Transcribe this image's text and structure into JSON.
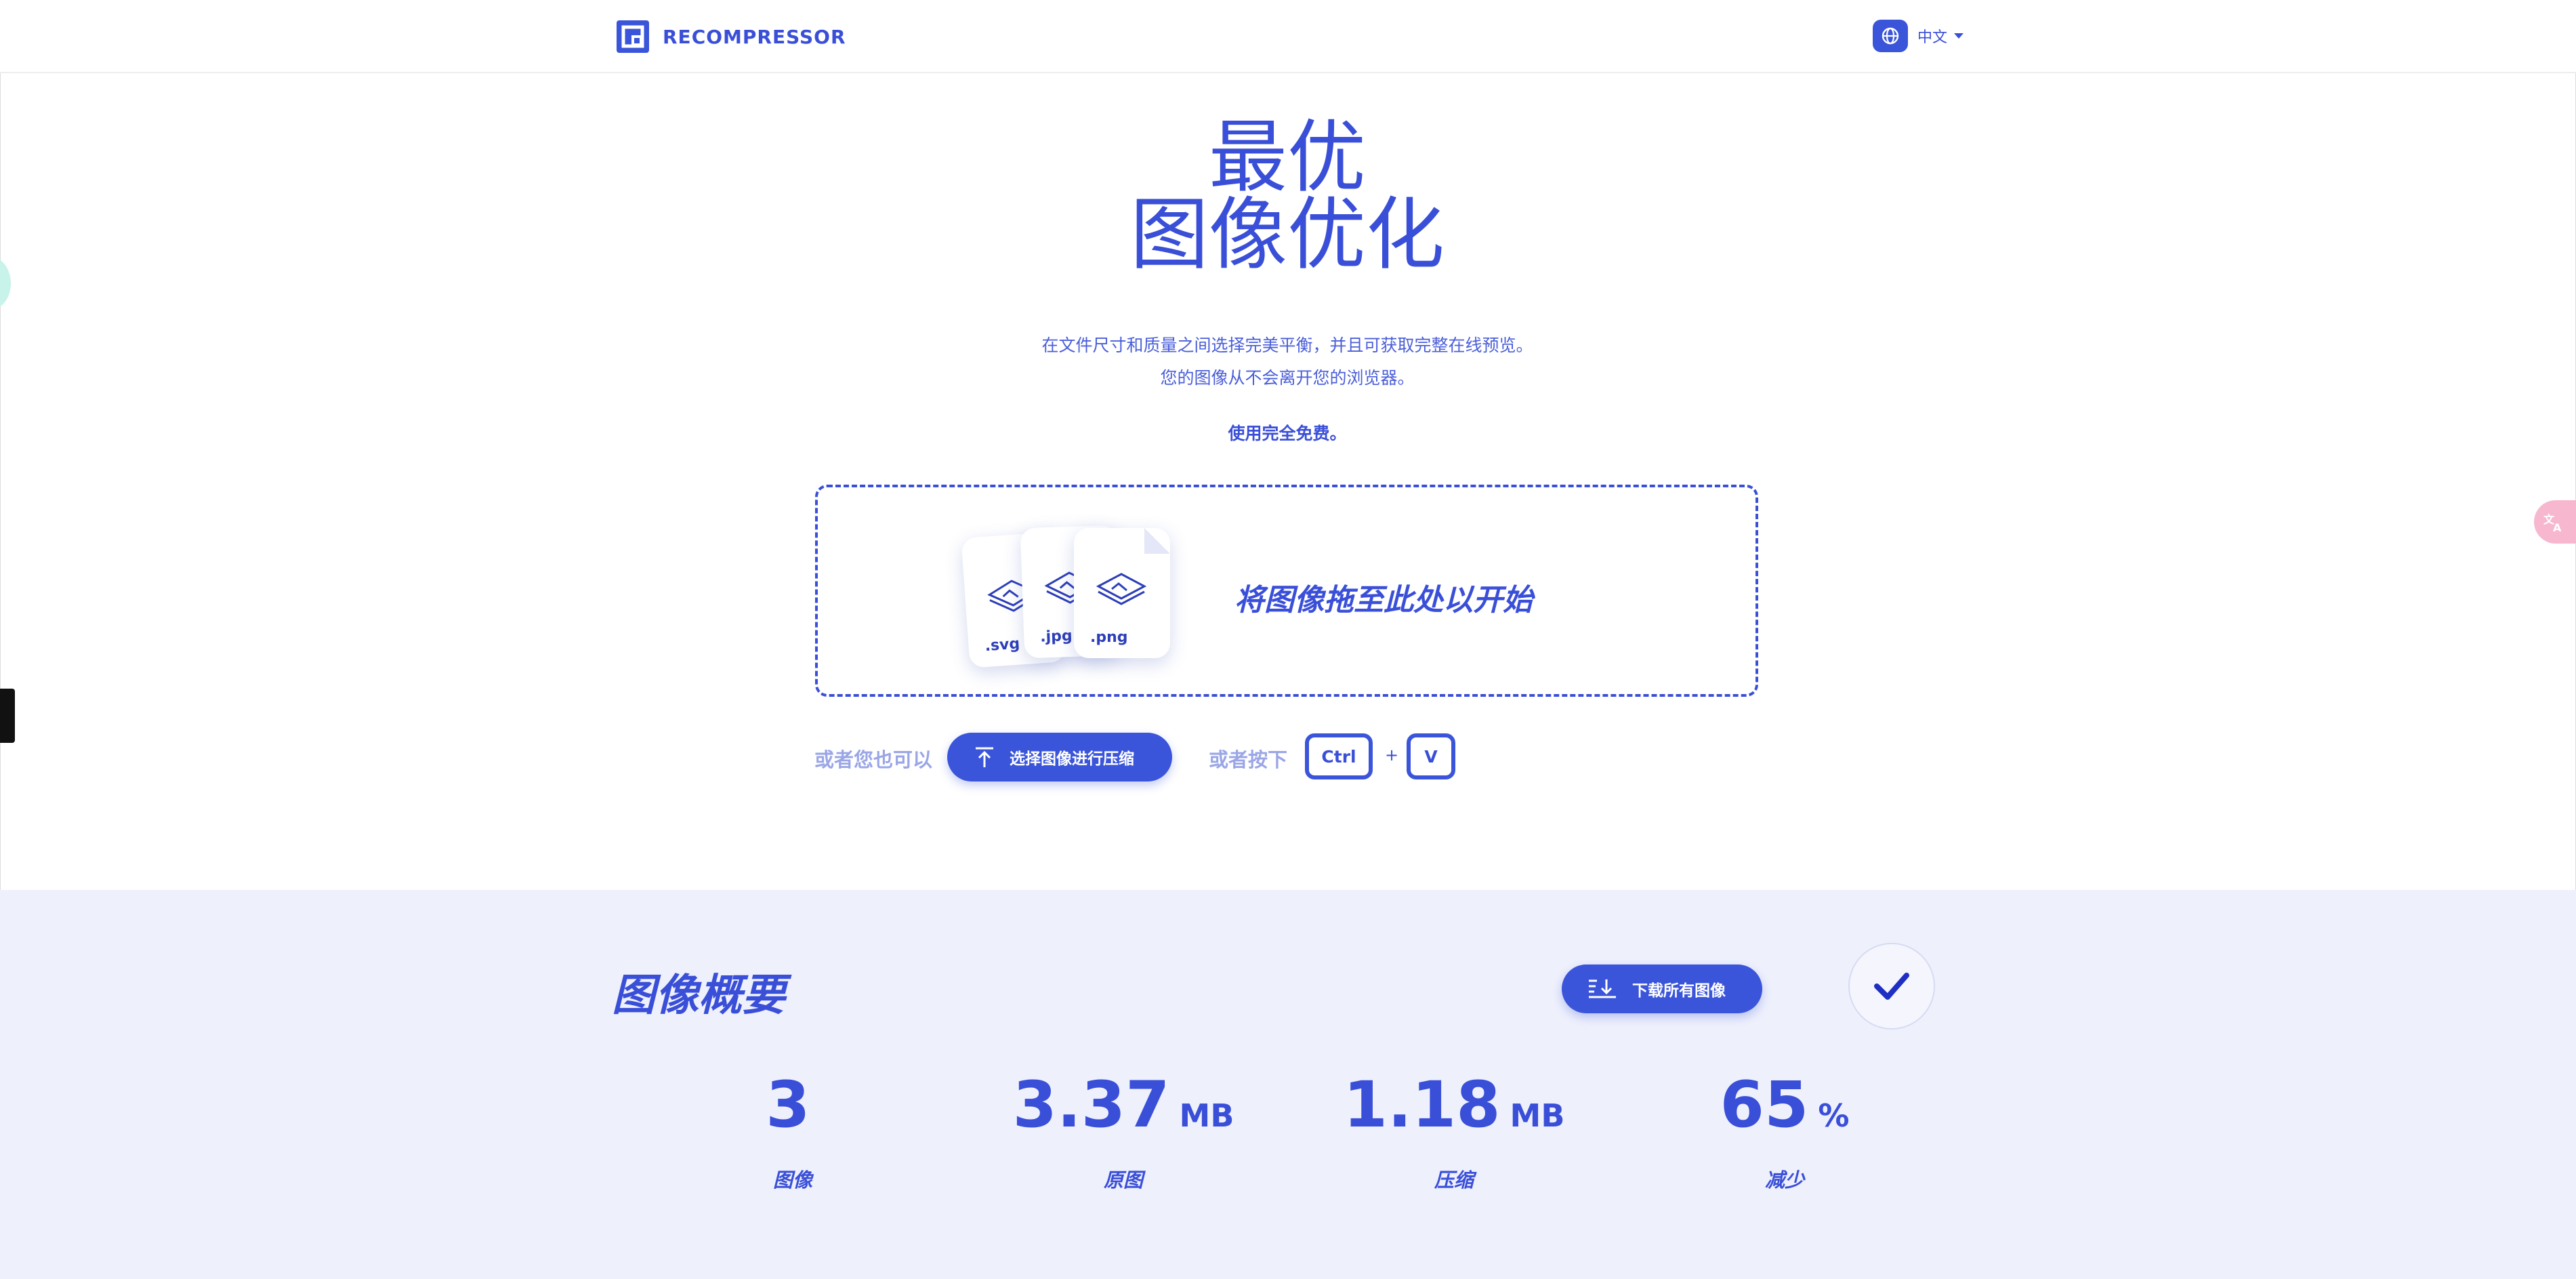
{
  "header": {
    "brand": "RECOMPRESSOR",
    "language": "中文"
  },
  "hero": {
    "title_line1": "最优",
    "title_line2": "图像优化",
    "subtitle_line1": "在文件尺寸和质量之间选择完美平衡，并且可获取完整在线预览。",
    "subtitle_line2": "您的图像从不会离开您的浏览器。",
    "free_note": "使用完全免费。"
  },
  "dropzone": {
    "cards": [
      ".svg",
      ".jpg",
      ".png"
    ],
    "prompt": "将图像拖至此处以开始"
  },
  "actions": {
    "or_you_can": "或者您也可以",
    "select_button": "选择图像进行压缩",
    "or_press": "或者按下",
    "key_ctrl": "Ctrl",
    "plus": "+",
    "key_v": "V"
  },
  "summary": {
    "title": "图像概要",
    "download_button": "下载所有图像",
    "stats": [
      {
        "value": "3",
        "unit": "",
        "caption": "图像"
      },
      {
        "value": "3.37",
        "unit": "MB",
        "caption": "原图"
      },
      {
        "value": "1.18",
        "unit": "MB",
        "caption": "压缩"
      },
      {
        "value": "65",
        "unit": "%",
        "caption": "减少"
      }
    ]
  },
  "colors": {
    "accent": "#3a55d9",
    "summary_background": "#eef0fc"
  },
  "icons": [
    "logo-icon",
    "globe-icon",
    "chevron-down-icon",
    "image-icon",
    "upload-arrow-icon",
    "download-icon",
    "checkmark-icon",
    "translate-icon"
  ]
}
